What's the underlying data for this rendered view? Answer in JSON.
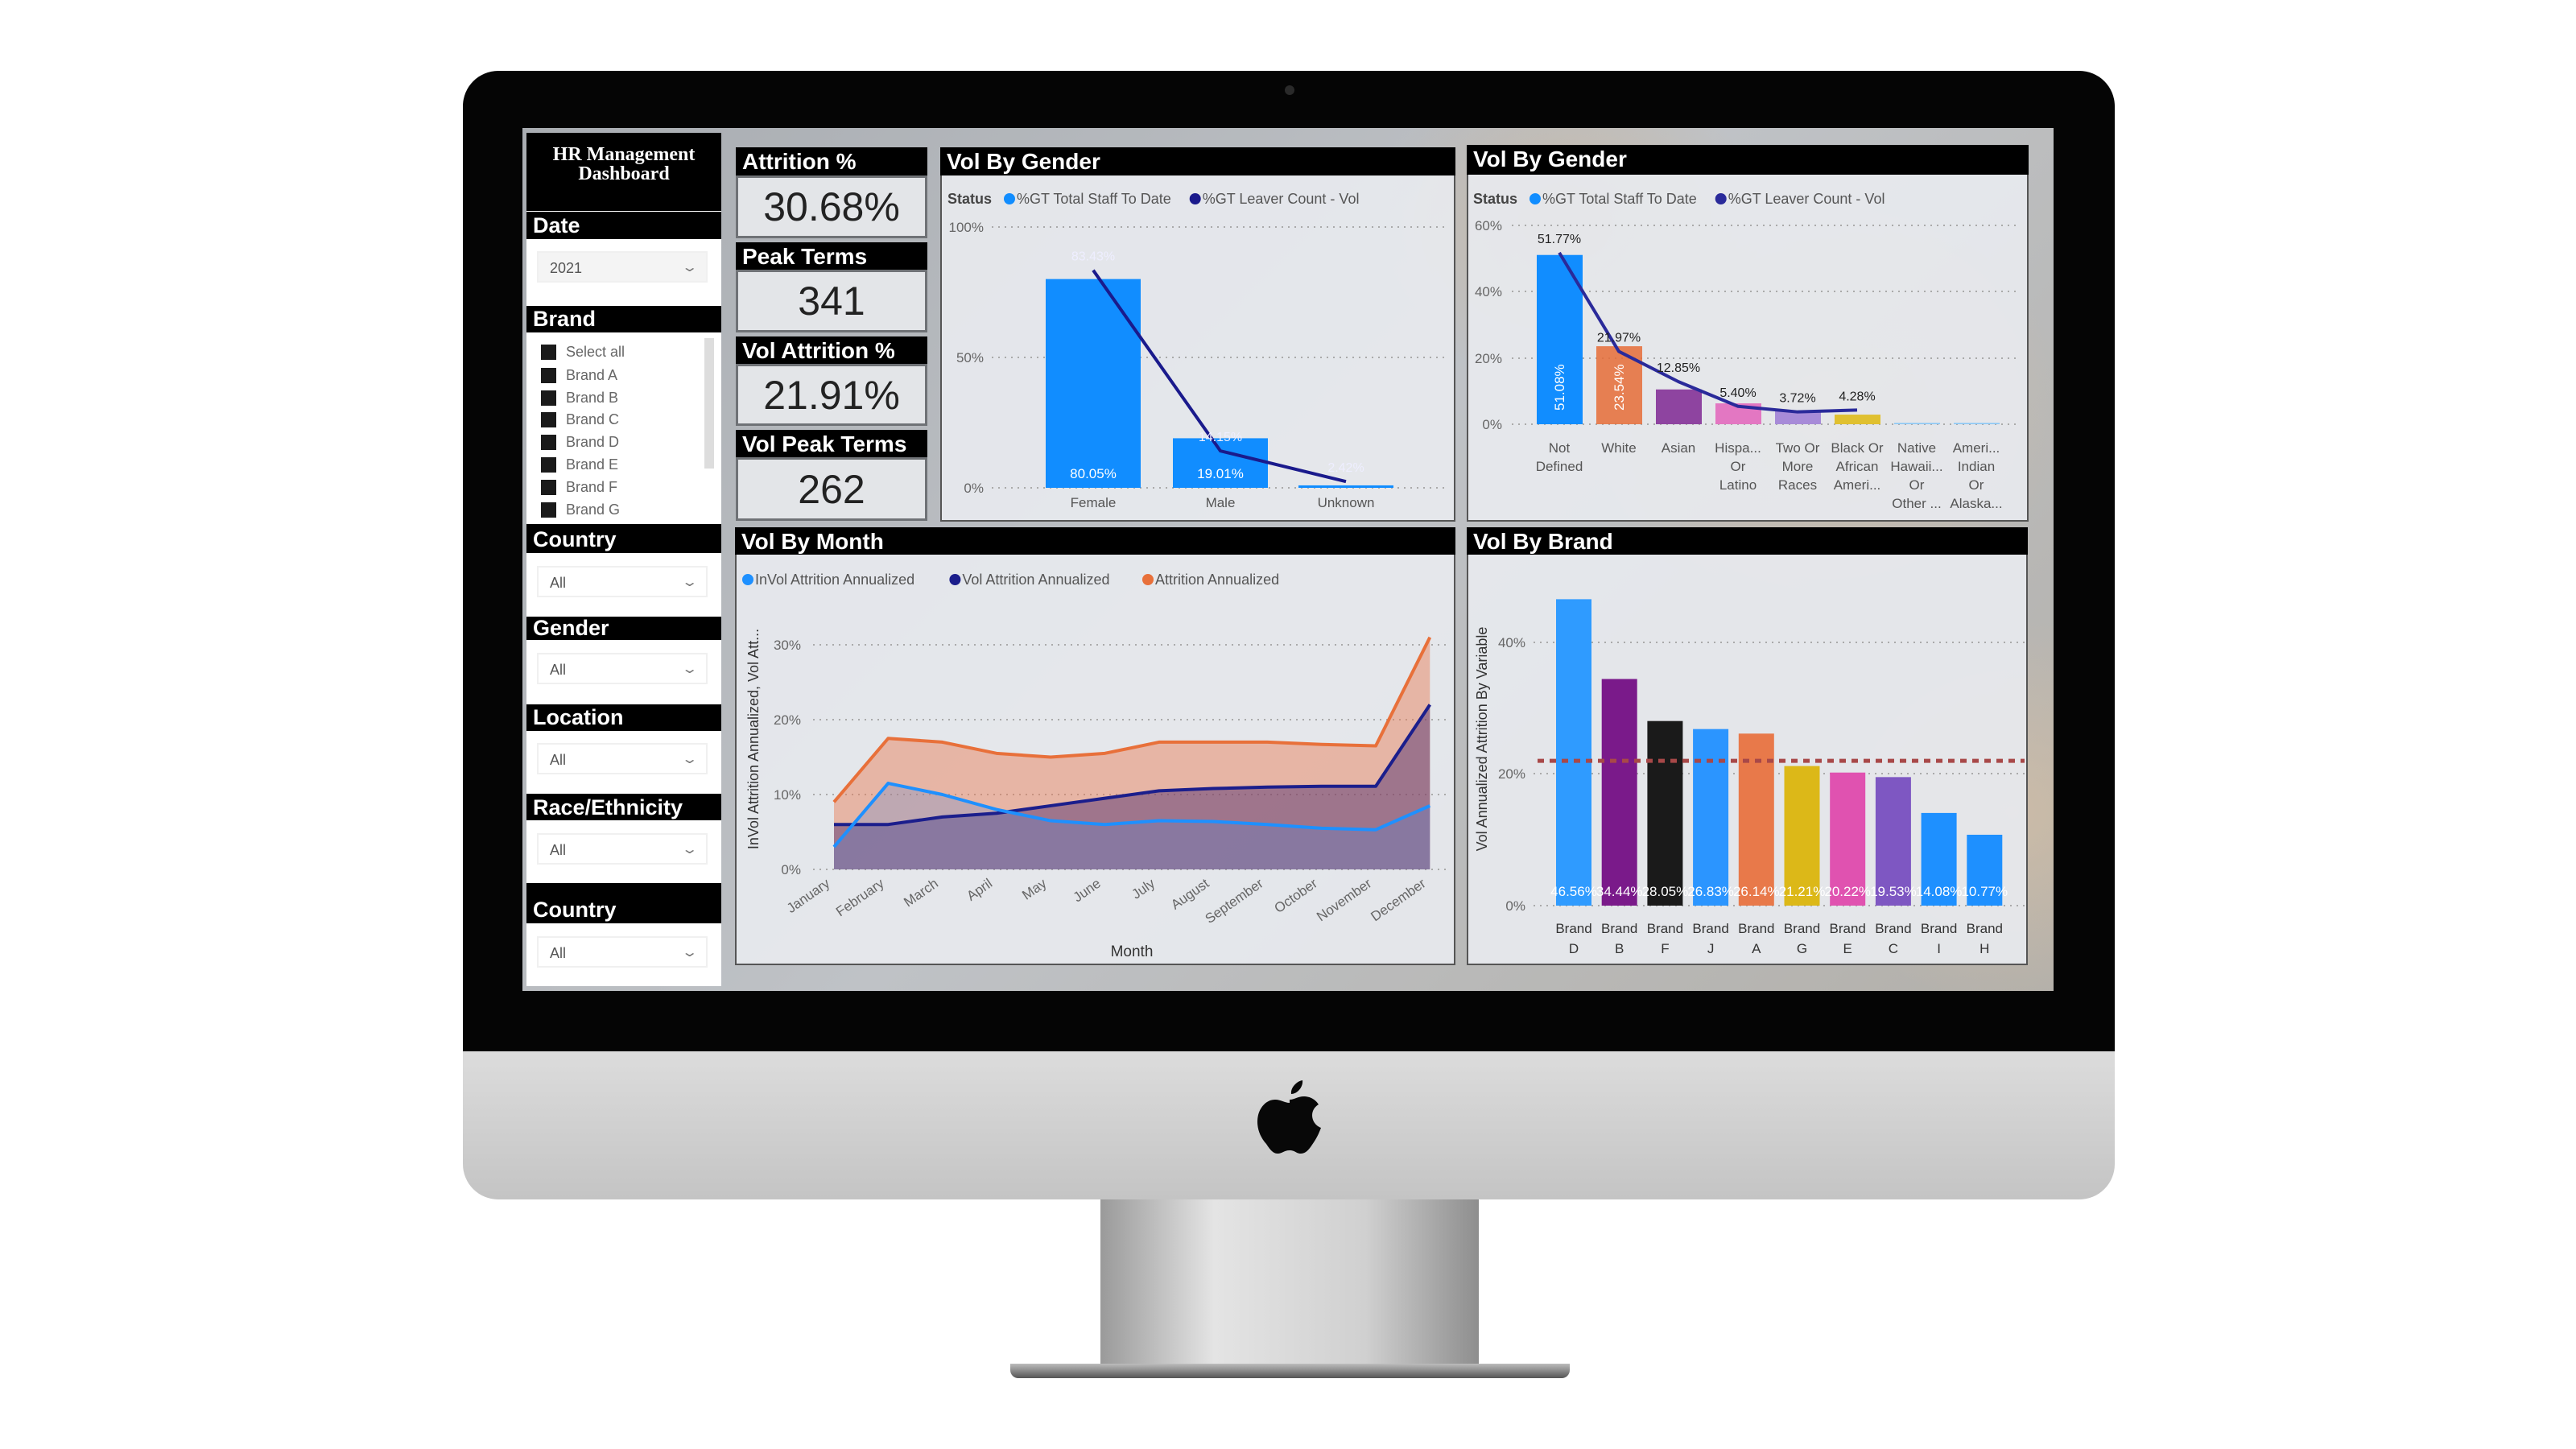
{
  "sidebar": {
    "title": "HR Management Dashboard",
    "date": {
      "label": "Date",
      "value": "2021"
    },
    "brand": {
      "label": "Brand",
      "items": [
        "Select all",
        "Brand A",
        "Brand B",
        "Brand C",
        "Brand D",
        "Brand E",
        "Brand F",
        "Brand G"
      ]
    },
    "country": {
      "label": "Country",
      "value": "All"
    },
    "gender": {
      "label": "Gender",
      "value": "All"
    },
    "location": {
      "label": "Location",
      "value": "All"
    },
    "race": {
      "label": "Race/Ethnicity",
      "value": "All"
    },
    "country2": {
      "label": "Country",
      "value": "All"
    }
  },
  "kpis": [
    {
      "label": "Attrition %",
      "value": "30.68%"
    },
    {
      "label": "Peak Terms",
      "value": "341"
    },
    {
      "label": "Vol Attrition %",
      "value": "21.91%"
    },
    {
      "label": "Vol Peak Terms",
      "value": "262"
    }
  ],
  "chart_data": [
    {
      "title": "Vol By Gender",
      "type": "bar+line",
      "legend_title": "Status",
      "legend": [
        "%GT Total Staff To Date",
        "%GT Leaver Count - Vol"
      ],
      "colors": {
        "bar": "#118dff",
        "line": "#1a1a8c"
      },
      "categories": [
        "Female",
        "Male",
        "Unknown"
      ],
      "series": [
        {
          "name": "%GT Total Staff To Date",
          "values": [
            80.05,
            19.01,
            0.94
          ],
          "labels": [
            "80.05%",
            "19.01%",
            ""
          ]
        },
        {
          "name": "%GT Leaver Count - Vol",
          "values": [
            83.43,
            14.15,
            2.42
          ],
          "labels": [
            "83.43%",
            "14.15%",
            "2.42%"
          ]
        }
      ],
      "yticks": [
        "0%",
        "50%",
        "100%"
      ],
      "ylim": [
        0,
        100
      ],
      "grid": true,
      "legend_position": "top-left"
    },
    {
      "title": "Vol By Gender",
      "type": "bar+line",
      "legend_title": "Status",
      "legend": [
        "%GT Total Staff To Date",
        "%GT Leaver Count - Vol"
      ],
      "colors": {
        "bars": [
          "#118dff",
          "#e66c37",
          "#8e44a0",
          "#e377c2",
          "#a78bd8",
          "#e0c030",
          "#8cc8f5",
          "#8cc8f5"
        ],
        "line": "#2a2a9a"
      },
      "categories": [
        [
          "Not",
          "Defined"
        ],
        [
          "White"
        ],
        [
          "Asian"
        ],
        [
          "Hispa...",
          "Or",
          "Latino"
        ],
        [
          "Two Or",
          "More",
          "Races"
        ],
        [
          "Black Or",
          "African",
          "Ameri..."
        ],
        [
          "Native",
          "Hawaii...",
          "Or",
          "Other ..."
        ],
        [
          "Ameri...",
          "Indian",
          "Or",
          "Alaska..."
        ]
      ],
      "series": [
        {
          "name": "%GT Total Staff To Date",
          "values": [
            51.08,
            23.54,
            10.5,
            6.3,
            4.1,
            2.9,
            0.4,
            0.4
          ],
          "labels": [
            "51.08%",
            "23.54%",
            "",
            "",
            "",
            "",
            "",
            ""
          ]
        },
        {
          "name": "%GT Leaver Count - Vol",
          "values": [
            51.77,
            21.97,
            12.85,
            5.4,
            3.72,
            4.28
          ],
          "labels": [
            "51.77%",
            "21.97%",
            "12.85%",
            "5.40%",
            "3.72%",
            "4.28%"
          ]
        }
      ],
      "yticks": [
        "0%",
        "20%",
        "40%",
        "60%"
      ],
      "ylim": [
        0,
        60
      ],
      "grid": true,
      "legend_position": "top-left"
    },
    {
      "title": "Vol By Month",
      "type": "area",
      "xlabel": "Month",
      "ylabel": "InVol Attrition Annualized, Vol Att...",
      "categories": [
        "January",
        "February",
        "March",
        "April",
        "May",
        "June",
        "July",
        "August",
        "September",
        "October",
        "November",
        "December"
      ],
      "series": [
        {
          "name": "InVol Attrition Annualized",
          "color": "#1e90ff",
          "values": [
            3,
            11.5,
            10,
            8,
            6.5,
            6,
            6.5,
            6.4,
            6,
            5.5,
            5.3,
            8.5
          ]
        },
        {
          "name": "Vol Attrition Annualized",
          "color": "#1b1e8c",
          "values": [
            6,
            6,
            7,
            7.5,
            8.5,
            9.5,
            10.5,
            10.8,
            11,
            11.1,
            11.1,
            22
          ]
        },
        {
          "name": "Attrition Annualized",
          "color": "#e8703a",
          "values": [
            9,
            17.5,
            17,
            15.5,
            15,
            15.5,
            17,
            17,
            17,
            16.7,
            16.5,
            31
          ]
        }
      ],
      "yticks": [
        "0%",
        "10%",
        "20%",
        "30%"
      ],
      "ylim": [
        0,
        32
      ],
      "grid": true,
      "legend_position": "top-left"
    },
    {
      "title": "Vol By Brand",
      "type": "bar",
      "ylabel": "Vol Annualized Attrition By Variable",
      "categories": [
        [
          "Brand",
          "D"
        ],
        [
          "Brand",
          "B"
        ],
        [
          "Brand",
          "F"
        ],
        [
          "Brand",
          "J"
        ],
        [
          "Brand",
          "A"
        ],
        [
          "Brand",
          "G"
        ],
        [
          "Brand",
          "E"
        ],
        [
          "Brand",
          "C"
        ],
        [
          "Brand",
          "I"
        ],
        [
          "Brand",
          "H"
        ]
      ],
      "values": [
        46.56,
        34.44,
        28.05,
        26.83,
        26.14,
        21.21,
        20.22,
        19.53,
        14.08,
        10.77
      ],
      "labels": [
        "46.56%",
        "34.44%",
        "28.05%",
        "26.83%",
        "26.14%",
        "21.21%",
        "20.22%",
        "19.53%",
        "14.08%",
        "10.77%"
      ],
      "colors": [
        "#2f9bff",
        "#7a1a8a",
        "#1a1a1a",
        "#2b95ff",
        "#e8794a",
        "#dcb818",
        "#e052b0",
        "#7e57c2",
        "#1e90ff",
        "#1e90ff"
      ],
      "reference_line": {
        "value": 22,
        "color": "#a84848",
        "style": "dashed"
      },
      "yticks": [
        "0%",
        "20%",
        "40%"
      ],
      "ylim": [
        0,
        50
      ],
      "grid": true
    }
  ]
}
